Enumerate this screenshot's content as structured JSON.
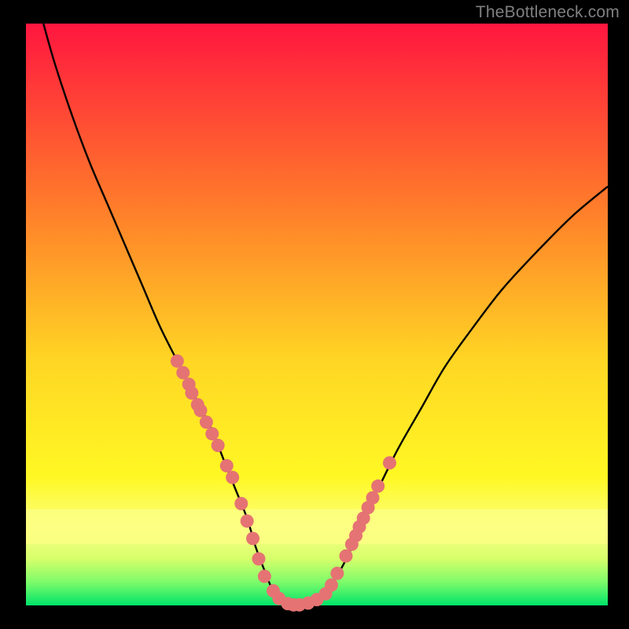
{
  "watermark": "TheBottleneck.com",
  "chart_data": {
    "type": "line",
    "title": "",
    "xlabel": "",
    "ylabel": "",
    "xlim": [
      0,
      100
    ],
    "ylim": [
      0,
      100
    ],
    "background_gradient": {
      "top": "#ff163f",
      "mid1": "#ff7e2a",
      "mid2": "#ffd624",
      "mid3": "#fff824",
      "bottom_band": "#fbff83",
      "bottom_edge": "#00e46a"
    },
    "series": [
      {
        "name": "bottleneck-curve",
        "stroke": "#000000",
        "x": [
          3,
          5,
          8,
          11,
          14,
          17,
          20,
          23,
          26,
          29,
          32,
          34,
          36,
          38,
          39.5,
          41,
          42,
          43,
          44,
          46,
          48,
          50,
          52,
          54,
          56,
          58,
          61,
          64,
          68,
          72,
          77,
          82,
          88,
          94,
          100
        ],
        "values": [
          100,
          93,
          84,
          76,
          69,
          62,
          55,
          48,
          42,
          36,
          30,
          25,
          20,
          15,
          10,
          6,
          3.5,
          1.5,
          0.5,
          0,
          0.3,
          1.2,
          3,
          6,
          10,
          15,
          21,
          27,
          34,
          41,
          48,
          54.5,
          61,
          67,
          72
        ]
      }
    ],
    "markers": {
      "name": "highlighted-points",
      "color": "#e57373",
      "x": [
        26.0,
        27.0,
        28.0,
        28.5,
        29.5,
        30.0,
        31.0,
        32.0,
        33.0,
        34.5,
        35.5,
        37.0,
        38.0,
        39.0,
        40.0,
        41.0,
        42.5,
        43.5,
        45.0,
        46.0,
        47.0,
        48.5,
        50.0,
        51.5,
        52.5,
        53.5,
        55.0,
        56.0,
        56.7,
        57.3,
        58.0,
        58.8,
        59.6,
        60.5,
        62.5
      ],
      "values": [
        42.0,
        40.0,
        38.0,
        36.5,
        34.5,
        33.5,
        31.5,
        29.5,
        27.5,
        24.0,
        22.0,
        17.5,
        14.5,
        11.5,
        8.0,
        5.0,
        2.5,
        1.2,
        0.3,
        0.1,
        0.1,
        0.4,
        1.0,
        2.0,
        3.5,
        5.5,
        8.5,
        10.5,
        12.0,
        13.5,
        15.0,
        16.8,
        18.5,
        20.5,
        24.5
      ]
    }
  }
}
